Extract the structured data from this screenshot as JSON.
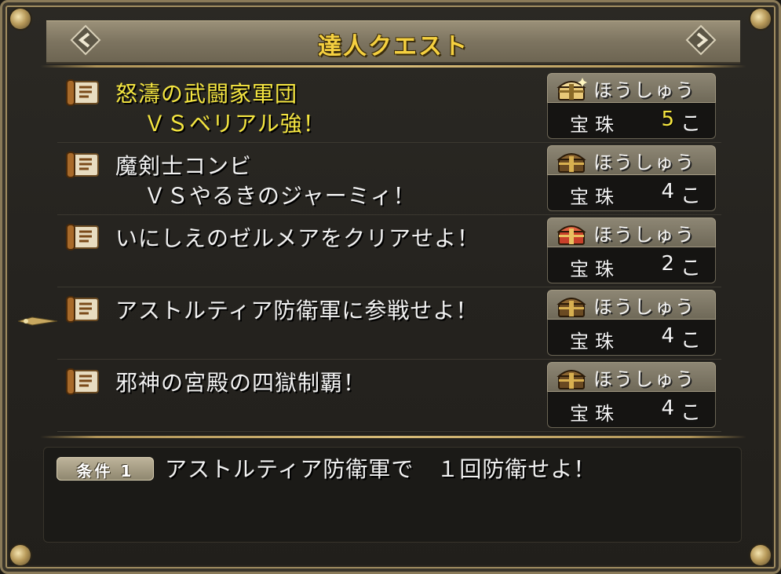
{
  "window": {
    "title": "達人クエスト"
  },
  "quests": [
    {
      "name_line1": "怒濤の武闘家軍団",
      "name_line2": "ＶＳベリアル強！",
      "reward_label": "ほうしゅう",
      "reward_item": "宝珠",
      "reward_count": "5",
      "reward_unit": "こ",
      "chest": "gold",
      "selected": true
    },
    {
      "name_line1": "魔剣士コンビ",
      "name_line2": "ＶＳやるきのジャーミィ！",
      "reward_label": "ほうしゅう",
      "reward_item": "宝珠",
      "reward_count": "4",
      "reward_unit": "こ",
      "chest": "dark",
      "selected": false
    },
    {
      "name_line1": "いにしえのゼルメアをクリアせよ！",
      "name_line2": "",
      "reward_label": "ほうしゅう",
      "reward_item": "宝珠",
      "reward_count": "2",
      "reward_unit": "こ",
      "chest": "red",
      "selected": false
    },
    {
      "name_line1": "アストルティア防衛軍に参戦せよ！",
      "name_line2": "",
      "reward_label": "ほうしゅう",
      "reward_item": "宝珠",
      "reward_count": "4",
      "reward_unit": "こ",
      "chest": "dark",
      "selected": false
    },
    {
      "name_line1": "邪神の宮殿の四獄制覇！",
      "name_line2": "",
      "reward_label": "ほうしゅう",
      "reward_item": "宝珠",
      "reward_count": "4",
      "reward_unit": "こ",
      "chest": "dark",
      "selected": false
    }
  ],
  "detail": {
    "condition_label": "条件 1",
    "condition_text": "アストルティア防衛軍で　１回防衛せよ！"
  },
  "colors": {
    "selected_text": "#f5e640",
    "title_text": "#f5d040",
    "frame_gold": "#a08c60"
  }
}
